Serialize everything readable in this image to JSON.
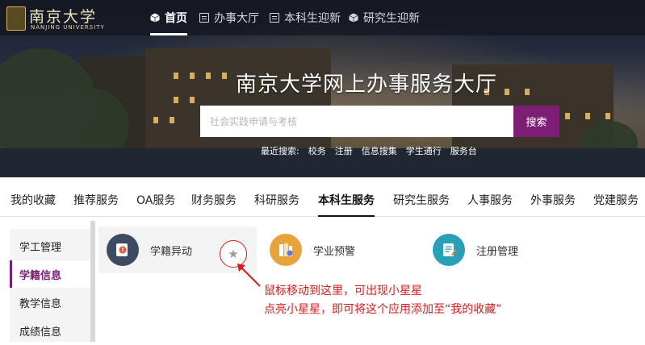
{
  "header": {
    "logo_cn": "南京大学",
    "logo_en": "NANJING UNIVERSITY",
    "nav": [
      {
        "label": "首页",
        "icon": "cube-icon",
        "active": true
      },
      {
        "label": "办事大厅",
        "icon": "document-icon",
        "active": false
      },
      {
        "label": "本科生迎新",
        "icon": "document-icon",
        "active": false
      },
      {
        "label": "研究生迎新",
        "icon": "cube-icon",
        "active": false
      }
    ]
  },
  "hero": {
    "title": "南京大学网上办事服务大厅",
    "search_placeholder": "社会实践申请与考核",
    "search_button": "搜索",
    "recent_label": "最近搜索:",
    "recent_items": [
      "校务",
      "注册",
      "信息搜集",
      "学生通行",
      "服务台"
    ]
  },
  "tabs": [
    "我的收藏",
    "推荐服务",
    "OA服务",
    "财务服务",
    "科研服务",
    "本科生服务",
    "研究生服务",
    "人事服务",
    "外事服务",
    "党建服务"
  ],
  "active_tab": "本科生服务",
  "sidebar": {
    "items": [
      {
        "label": "学工管理",
        "active": false
      },
      {
        "label": "学籍信息",
        "active": true
      },
      {
        "label": "教学信息",
        "active": false
      },
      {
        "label": "成绩信息",
        "active": false
      }
    ]
  },
  "apps": [
    {
      "label": "学籍异动",
      "icon": "student-status-icon",
      "color": "#3d4a63"
    },
    {
      "label": "学业预警",
      "icon": "academic-warning-icon",
      "color": "#e8a33c"
    },
    {
      "label": "注册管理",
      "icon": "registration-icon",
      "color": "#2aa0b8"
    }
  ],
  "favorite_star": "★",
  "annotation": {
    "line1": "鼠标移动到这里，可出现小星星",
    "line2": "点亮小星星，即可将这个应用添加至“我的收藏”"
  },
  "colors": {
    "accent": "#7b1e74",
    "annotation": "#d21e1e"
  }
}
